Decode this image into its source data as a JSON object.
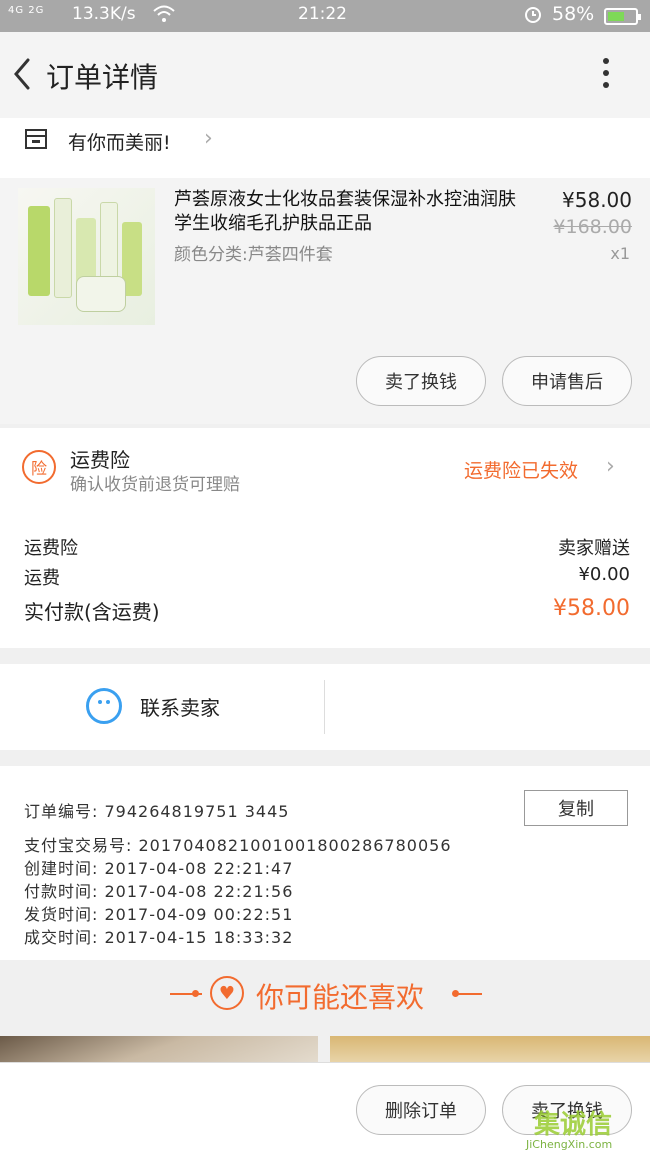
{
  "status_bar": {
    "signal": "4G 2G",
    "speed": "13.3K/s",
    "time": "21:22",
    "battery": "58%"
  },
  "header": {
    "title": "订单详情"
  },
  "shop": {
    "name": "有你而美丽!"
  },
  "product": {
    "name": "芦荟原液女士化妆品套装保湿补水控油润肤学生收缩毛孔护肤品正品",
    "variant": "颜色分类:芦荟四件套",
    "price": "¥58.00",
    "original_price": "¥168.00",
    "quantity": "x1",
    "buttons": {
      "resell": "卖了换钱",
      "after_sales": "申请售后"
    }
  },
  "insurance": {
    "badge": "险",
    "title": "运费险",
    "subtitle": "确认收货前退货可理赔",
    "status": "运费险已失效"
  },
  "fees": {
    "rows": [
      {
        "label": "运费险",
        "value": "卖家赠送"
      },
      {
        "label": "运费",
        "value": "¥0.00"
      }
    ],
    "paid_label": "实付款(含运费)",
    "paid_value": "¥58.00"
  },
  "contact": {
    "label": "联系卖家"
  },
  "order_info": {
    "order_no": "订单编号:  794264819751 3445",
    "copy_button": "复制",
    "alipay_no": "支付宝交易号:  2017040821001001800286780056",
    "created": "创建时间:  2017-04-08  22:21:47",
    "paid": "付款时间:  2017-04-08  22:21:56",
    "shipped": "发货时间:  2017-04-09  00:22:51",
    "completed": "成交时间:  2017-04-15  18:33:32"
  },
  "recommend": {
    "title": "你可能还喜欢"
  },
  "bottom_bar": {
    "delete_order": "删除订单",
    "resell": "卖了换钱"
  },
  "watermark": {
    "main": "集诚信",
    "sub": "JiChengXin.com"
  },
  "colors": {
    "accent": "#f26b2f",
    "link_blue": "#3aa0f0"
  }
}
